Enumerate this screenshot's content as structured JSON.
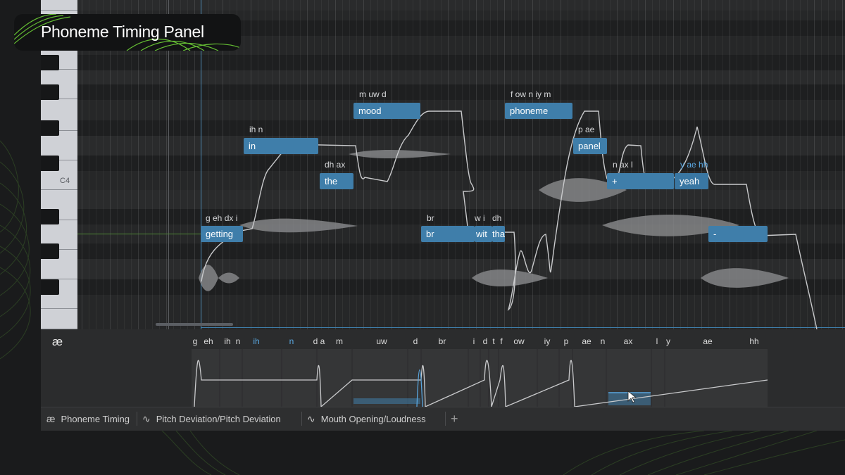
{
  "title": "Phoneme Timing Panel",
  "piano": {
    "c4_label": "C4"
  },
  "notes": [
    {
      "lyric": "getting",
      "phonemes": "g eh dx i",
      "highlight": false
    },
    {
      "lyric": "in",
      "phonemes": "ih n",
      "highlight": false
    },
    {
      "lyric": "the",
      "phonemes": "dh ax",
      "highlight": false
    },
    {
      "lyric": "mood",
      "phonemes": "m uw d",
      "highlight": false
    },
    {
      "lyric": "br",
      "phonemes": "br",
      "highlight": false
    },
    {
      "lyric": "wit",
      "phonemes": "w i",
      "highlight": false
    },
    {
      "lyric": "tha",
      "phonemes": "dh",
      "highlight": false
    },
    {
      "lyric": "phoneme",
      "phonemes": "f ow n iy m",
      "highlight": false
    },
    {
      "lyric": "panel",
      "phonemes": "p ae",
      "highlight": false
    },
    {
      "lyric": "+",
      "phonemes": "n ax l",
      "highlight": false
    },
    {
      "lyric": "yeah",
      "phonemes": "y ae hh",
      "highlight": true
    },
    {
      "lyric": "-",
      "phonemes": "",
      "highlight": false
    }
  ],
  "phoneme_lane": {
    "icon": "æ",
    "labels": [
      {
        "text": "g",
        "highlight": false
      },
      {
        "text": "eh",
        "highlight": false
      },
      {
        "text": "ih",
        "highlight": false
      },
      {
        "text": "n",
        "highlight": false
      },
      {
        "text": "ih",
        "highlight": true
      },
      {
        "text": "n",
        "highlight": true
      },
      {
        "text": "d",
        "highlight": false
      },
      {
        "text": "a",
        "highlight": false
      },
      {
        "text": "m",
        "highlight": false
      },
      {
        "text": "uw",
        "highlight": false
      },
      {
        "text": "d",
        "highlight": false
      },
      {
        "text": "br",
        "highlight": false
      },
      {
        "text": "i",
        "highlight": false
      },
      {
        "text": "d",
        "highlight": false
      },
      {
        "text": "t",
        "highlight": false
      },
      {
        "text": "f",
        "highlight": false
      },
      {
        "text": "ow",
        "highlight": false
      },
      {
        "text": "iy",
        "highlight": false
      },
      {
        "text": "p",
        "highlight": false
      },
      {
        "text": "ae",
        "highlight": false
      },
      {
        "text": "n",
        "highlight": false
      },
      {
        "text": "ax",
        "highlight": false
      },
      {
        "text": "l",
        "highlight": false
      },
      {
        "text": "y",
        "highlight": false
      },
      {
        "text": "ae",
        "highlight": false
      },
      {
        "text": "hh",
        "highlight": false
      }
    ]
  },
  "tabs": [
    {
      "icon": "æ",
      "label": "Phoneme Timing"
    },
    {
      "icon": "∿",
      "label": "Pitch Deviation/Pitch Deviation"
    },
    {
      "icon": "∿",
      "label": "Mouth Opening/Loudness"
    }
  ],
  "add_tab": "+",
  "colors": {
    "accent": "#3f7eaa",
    "highlight_text": "#5aa7e0",
    "background": "#1a1b1c",
    "deco_green": "#6ed037"
  }
}
